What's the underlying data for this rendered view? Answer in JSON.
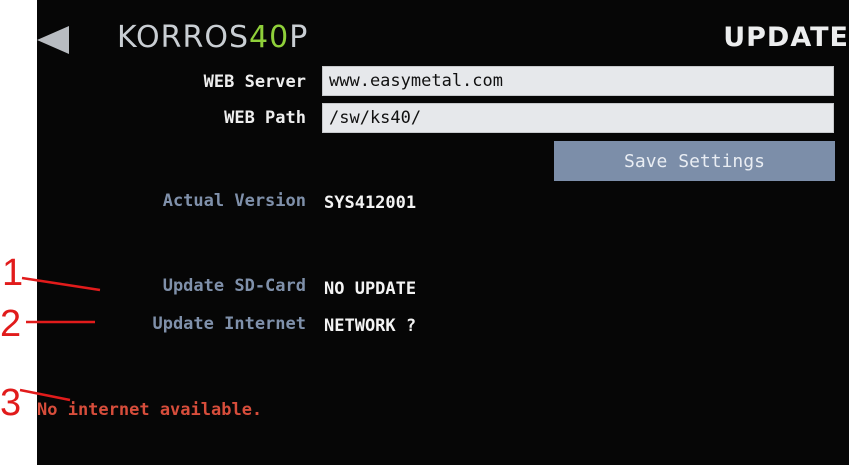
{
  "header": {
    "logo": {
      "part1": "KORROS",
      "part2": "40",
      "part3": "P"
    },
    "title": "UPDATE"
  },
  "settings": {
    "web_server_label": "WEB Server",
    "web_server_value": "www.easymetal.com",
    "web_path_label": "WEB Path",
    "web_path_value": "/sw/ks40/",
    "save_label": "Save Settings"
  },
  "version": {
    "actual_label": "Actual Version",
    "actual_value": "SYS412001"
  },
  "updates": {
    "sd_label": "Update SD-Card",
    "sd_value": "NO UPDATE",
    "internet_label": "Update Internet",
    "internet_value": "NETWORK ?"
  },
  "status": {
    "message": "No internet available."
  },
  "annotations": {
    "m1": "1",
    "m2": "2",
    "m3": "3"
  },
  "colors": {
    "accent_green": "#8fd03a",
    "label_blue": "#7f90aa",
    "button": "#7c8ea9",
    "error_red": "#d74d3b",
    "marker_red": "#e11b1b"
  }
}
